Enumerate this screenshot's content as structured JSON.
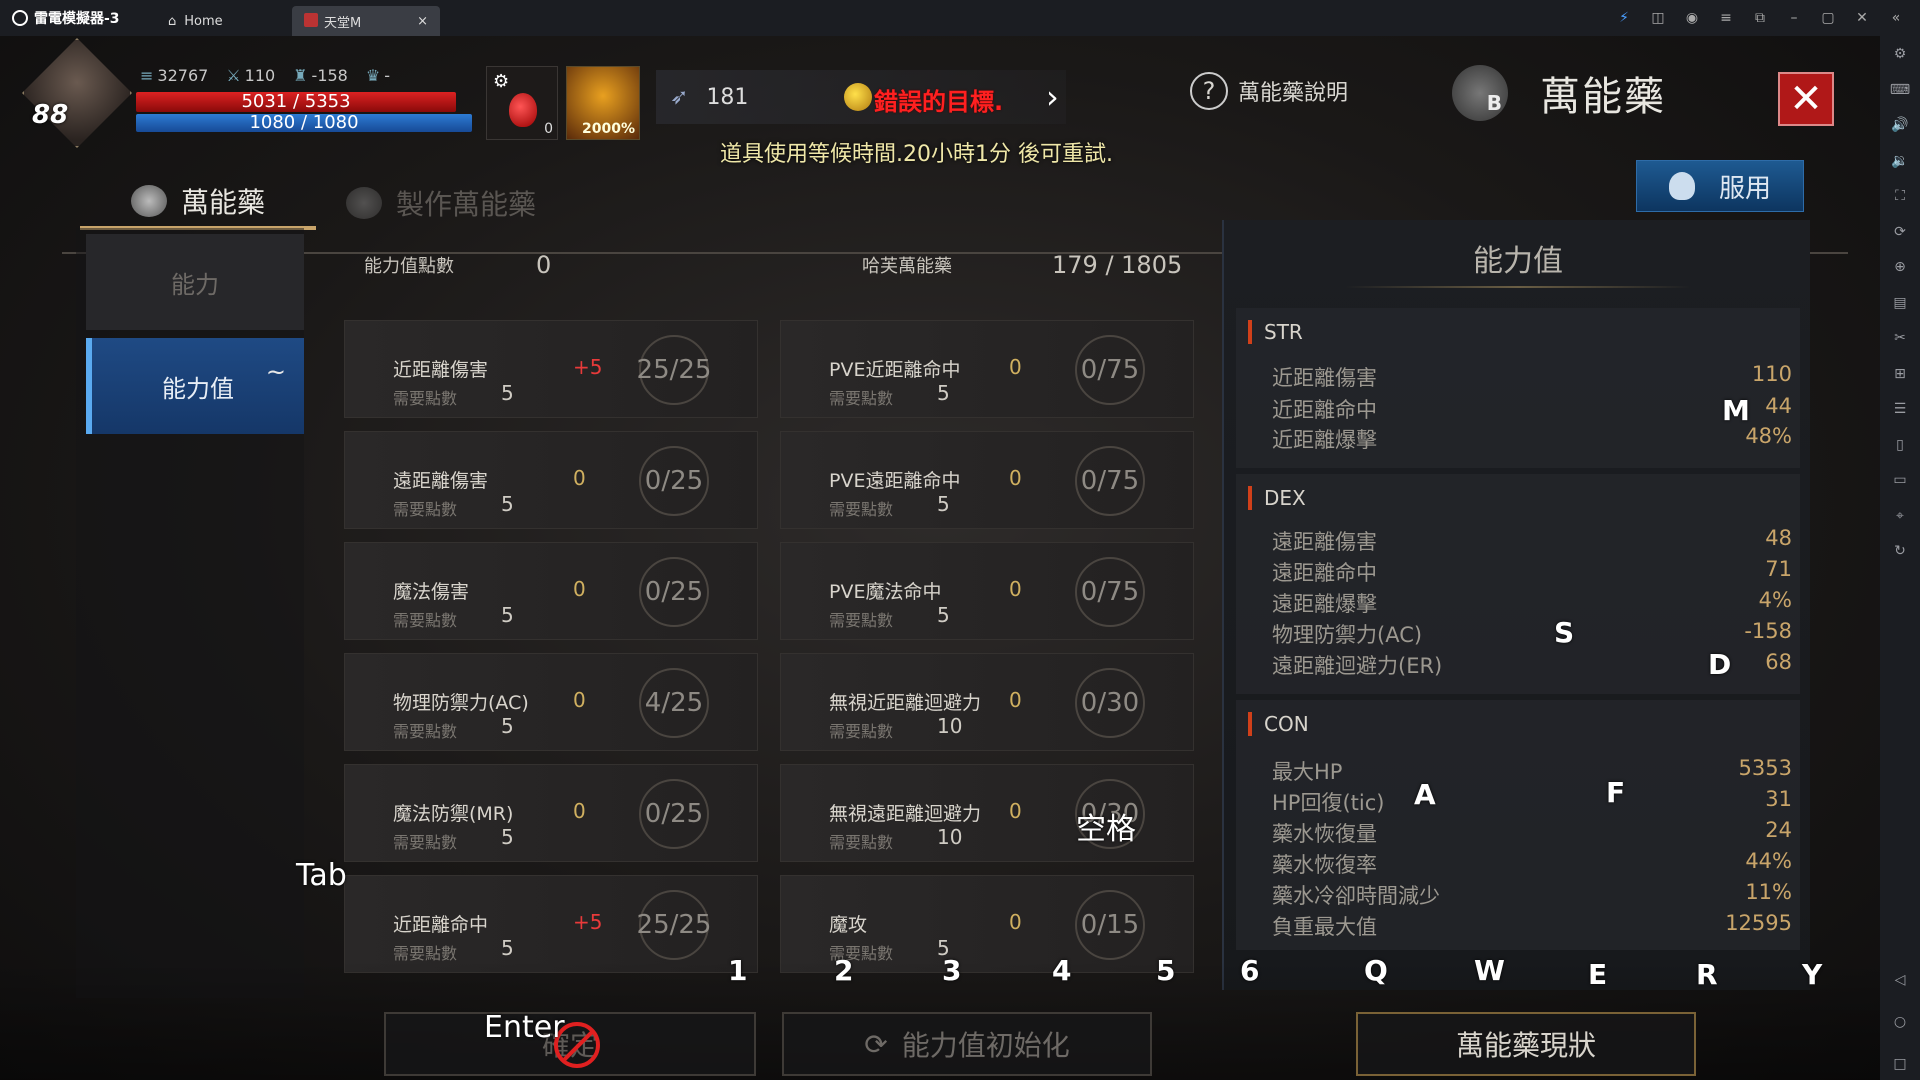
{
  "titlebar": {
    "app_name": "雷電模擬器-3",
    "home_tab": "Home",
    "game_tab": "天堂M",
    "icons": [
      "bolt-icon",
      "gamepad-icon",
      "user-icon",
      "menu-icon",
      "restore-icon",
      "minimize-icon",
      "maximize-icon",
      "close-icon",
      "collapse-icon"
    ]
  },
  "sidebar": {
    "icons": [
      "settings-icon",
      "keyboard-icon",
      "volume-up-icon",
      "volume-down-icon",
      "screenshot-icon",
      "sync-icon",
      "add-app-icon",
      "apk-icon",
      "scissors-icon",
      "multi-window-icon",
      "notes-icon",
      "shake-icon",
      "folder-icon",
      "location-icon",
      "rotate-icon"
    ],
    "nav": [
      "back-icon",
      "home-circle-icon",
      "recent-square-icon"
    ]
  },
  "hud": {
    "level": "88",
    "stat_exp": "32767",
    "stat_attack": "110",
    "stat_ac": "-158",
    "stat_trophy": "-",
    "hp_text": "5031 / 5353",
    "hp_fraction": 0.94,
    "mp_text": "1080 / 1080",
    "mp_fraction": 1.0,
    "slot1_count": "0",
    "slot2_count": "2000%",
    "feather_count": "181",
    "currency_error": "錯誤的目標.",
    "cooldown_msg": "道具使用等候時間.20小時1分 後可重試."
  },
  "header": {
    "help_label": "萬能藥說明",
    "title": "萬能藥",
    "crest_letter": "B",
    "close_symbol": "✕"
  },
  "tabs": {
    "active": "萬能藥",
    "inactive": "製作萬能藥",
    "take_button": "服用"
  },
  "leftnav": {
    "item1": "能力",
    "item2": "能力值",
    "item2_mark": "~"
  },
  "center": {
    "points_label": "能力值點數",
    "points_value": "0",
    "elixir_label": "哈芙萬能藥",
    "elixir_value": "179 / 1805",
    "req_label": "需要點數",
    "cards": [
      {
        "name": "近距離傷害",
        "req": "5",
        "bonus": "+5",
        "progress": "25/25"
      },
      {
        "name": "PVE近距離命中",
        "req": "5",
        "bonus": "0",
        "progress": "0/75"
      },
      {
        "name": "遠距離傷害",
        "req": "5",
        "bonus": "0",
        "progress": "0/25"
      },
      {
        "name": "PVE遠距離命中",
        "req": "5",
        "bonus": "0",
        "progress": "0/75"
      },
      {
        "name": "魔法傷害",
        "req": "5",
        "bonus": "0",
        "progress": "0/25"
      },
      {
        "name": "PVE魔法命中",
        "req": "5",
        "bonus": "0",
        "progress": "0/75"
      },
      {
        "name": "物理防禦力(AC)",
        "req": "5",
        "bonus": "0",
        "progress": "4/25"
      },
      {
        "name": "無視近距離迴避力",
        "req": "10",
        "bonus": "0",
        "progress": "0/30"
      },
      {
        "name": "魔法防禦(MR)",
        "req": "5",
        "bonus": "0",
        "progress": "0/25"
      },
      {
        "name": "無視遠距離迴避力",
        "req": "10",
        "bonus": "0",
        "progress": "0/30"
      },
      {
        "name": "近距離命中",
        "req": "5",
        "bonus": "+5",
        "progress": "25/25"
      },
      {
        "name": "魔攻",
        "req": "5",
        "bonus": "0",
        "progress": "0/15"
      }
    ]
  },
  "stats": {
    "title": "能力值",
    "str": {
      "header": "STR",
      "rows": [
        {
          "label": "近距離傷害",
          "value": "110"
        },
        {
          "label": "近距離命中",
          "value": "44"
        },
        {
          "label": "近距離爆擊",
          "value": "48%"
        }
      ]
    },
    "dex": {
      "header": "DEX",
      "rows": [
        {
          "label": "遠距離傷害",
          "value": "48"
        },
        {
          "label": "遠距離命中",
          "value": "71"
        },
        {
          "label": "遠距離爆擊",
          "value": "4%"
        },
        {
          "label": "物理防禦力(AC)",
          "value": "-158"
        },
        {
          "label": "遠距離迴避力(ER)",
          "value": "68"
        }
      ]
    },
    "con": {
      "header": "CON",
      "rows": [
        {
          "label": "最大HP",
          "value": "5353"
        },
        {
          "label": "HP回復(tic)",
          "value": "31"
        },
        {
          "label": "藥水恢復量",
          "value": "24"
        },
        {
          "label": "藥水恢復率",
          "value": "44%"
        },
        {
          "label": "藥水冷卻時間減少",
          "value": "11%"
        },
        {
          "label": "負重最大值",
          "value": "12595"
        }
      ]
    }
  },
  "bottom": {
    "btn_disabled": "確定",
    "btn_reset": "能力值初始化",
    "btn_status": "萬能藥現狀"
  },
  "keymap": {
    "enter": "Enter",
    "tab": "Tab",
    "space": "空格",
    "k1": "1",
    "k2": "2",
    "k3": "3",
    "k4": "4",
    "k5": "5",
    "k6": "6",
    "q": "Q",
    "w": "W",
    "e": "E",
    "r": "R",
    "y": "Y",
    "m": "M",
    "s": "S",
    "d": "D",
    "a": "A",
    "f": "F"
  }
}
